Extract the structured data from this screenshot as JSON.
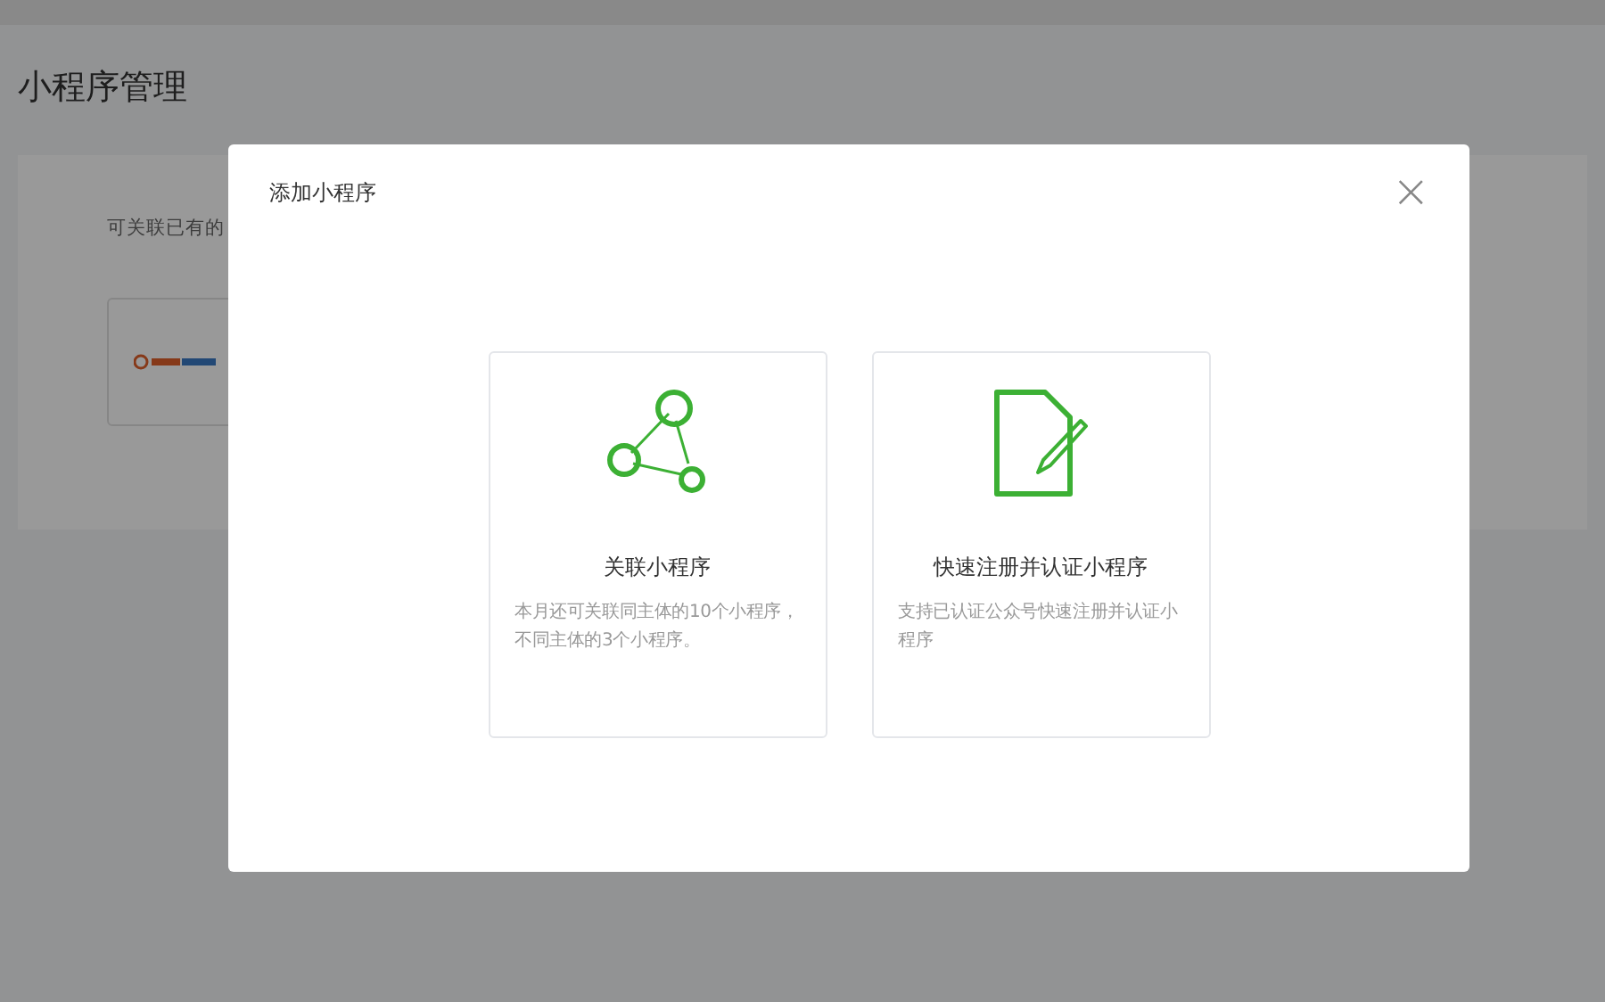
{
  "page": {
    "title": "小程序管理",
    "intro": "可关联已有的"
  },
  "dialog": {
    "title": "添加小程序",
    "close": "×",
    "options": [
      {
        "kind": "link",
        "title": "关联小程序",
        "description": "本月还可关联同主体的10个小程序，不同主体的3个小程序。"
      },
      {
        "kind": "register",
        "title": "快速注册并认证小程序",
        "description": "支持已认证公众号快速注册并认证小程序"
      }
    ]
  }
}
